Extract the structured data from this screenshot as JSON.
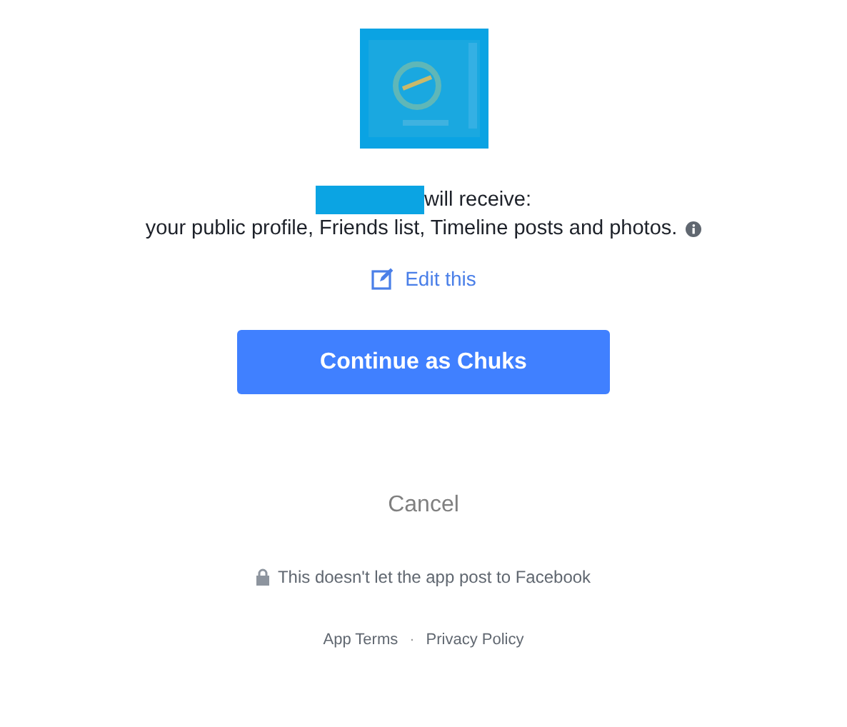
{
  "permissions": {
    "heading": "will receive:",
    "details": "your public profile, Friends list, Timeline posts and photos."
  },
  "edit_link": "Edit this",
  "continue_button": "Continue as Chuks",
  "cancel_button": "Cancel",
  "notice": "This doesn't let the app post to Facebook",
  "footer": {
    "links": [
      "App Terms",
      "Privacy Policy"
    ],
    "separator": "·"
  }
}
